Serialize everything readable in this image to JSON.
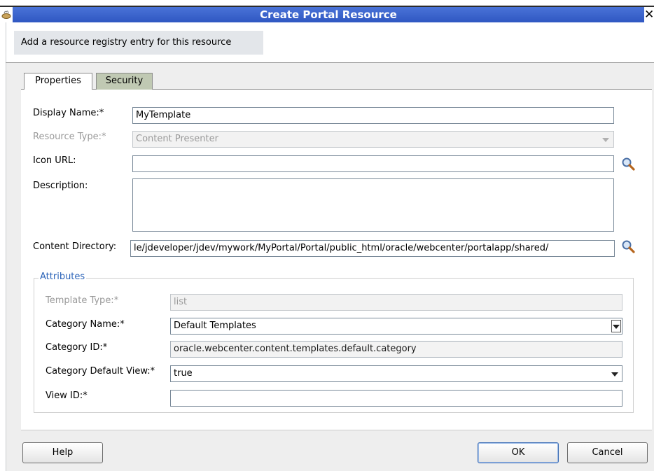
{
  "window": {
    "title": "Create Portal Resource"
  },
  "header": {
    "text": "Add a resource registry entry for this resource"
  },
  "tabs": [
    {
      "label": "Properties",
      "selected": true
    },
    {
      "label": "Security",
      "selected": false
    }
  ],
  "form": {
    "display_name": {
      "label": "Display Name:*",
      "value": "MyTemplate"
    },
    "resource_type": {
      "label": "Resource Type:*",
      "value": "Content Presenter"
    },
    "icon_url": {
      "label": "Icon URL:",
      "value": ""
    },
    "description": {
      "label": "Description:",
      "value": ""
    },
    "content_directory": {
      "label": "Content Directory:",
      "value": "le/jdeveloper/jdev/mywork/MyPortal/Portal/public_html/oracle/webcenter/portalapp/shared/"
    }
  },
  "attributes": {
    "title": "Attributes",
    "template_type": {
      "label": "Template Type:*",
      "value": "list"
    },
    "category_name": {
      "label": "Category Name:*",
      "value": "Default Templates"
    },
    "category_id": {
      "label": "Category ID:*",
      "value": "oracle.webcenter.content.templates.default.category"
    },
    "category_default_view": {
      "label": "Category Default View:*",
      "value": "true"
    },
    "view_id": {
      "label": "View ID:*",
      "value": ""
    }
  },
  "buttons": {
    "help": "Help",
    "ok": "OK",
    "cancel": "Cancel"
  },
  "colors": {
    "title_bar": "#3a63cc",
    "group_title": "#2b63b8",
    "tab_inactive": "#c0c9b3"
  }
}
